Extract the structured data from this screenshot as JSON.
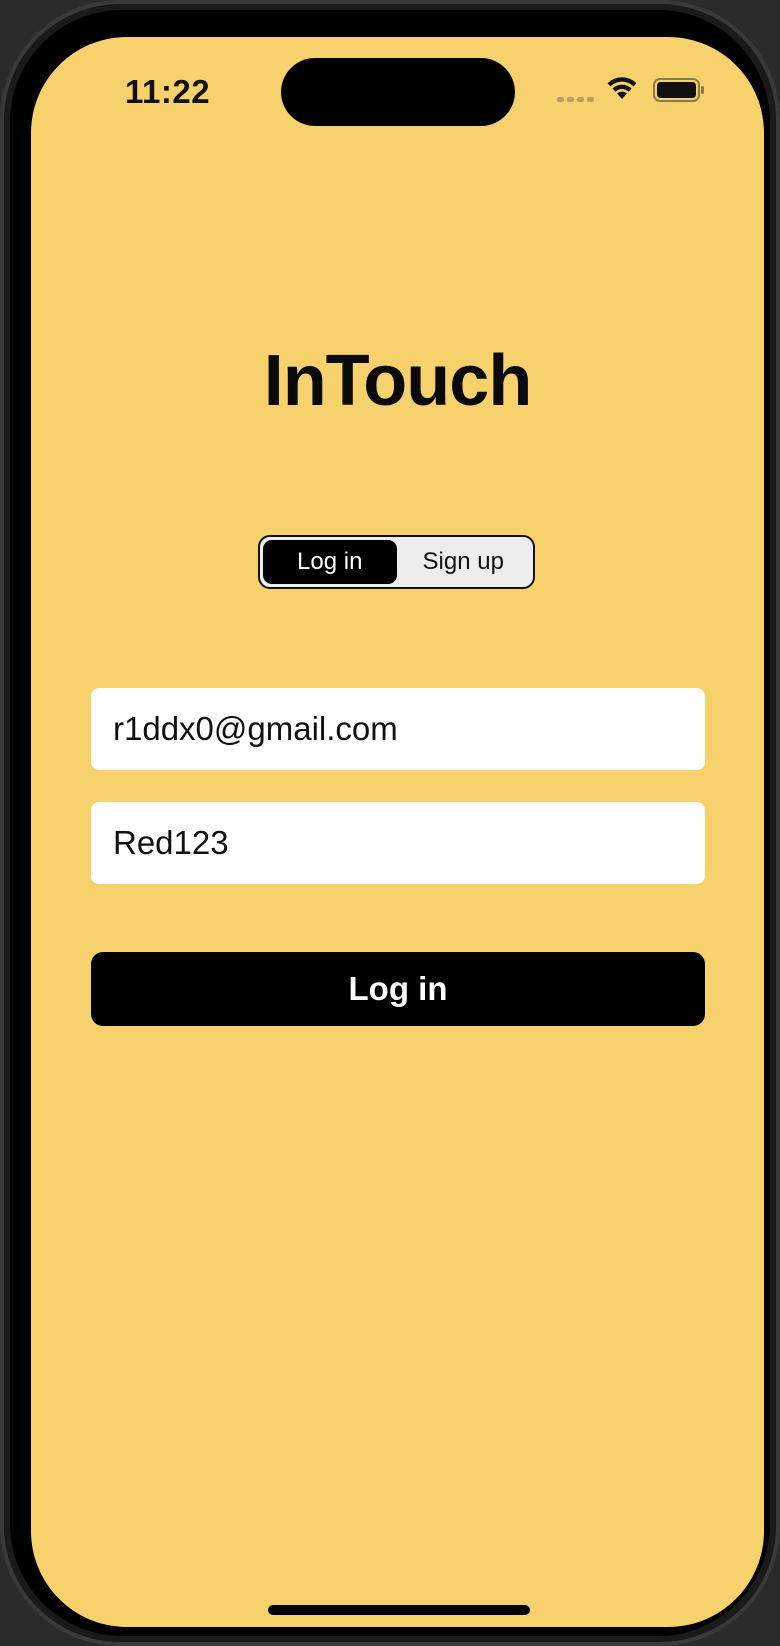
{
  "status_bar": {
    "time": "11:22",
    "icons": [
      "cellular-signal-icon",
      "wifi-icon",
      "battery-icon"
    ]
  },
  "app": {
    "title": "InTouch"
  },
  "mode_switch": {
    "options": [
      "Log in",
      "Sign up"
    ],
    "selected": "Log in"
  },
  "form": {
    "email_value": "r1ddx0@gmail.com",
    "password_value": "Red123",
    "submit_label": "Log in"
  },
  "colors": {
    "background": "#f7d26c",
    "accent": "#000000",
    "field_background": "#ffffff"
  }
}
